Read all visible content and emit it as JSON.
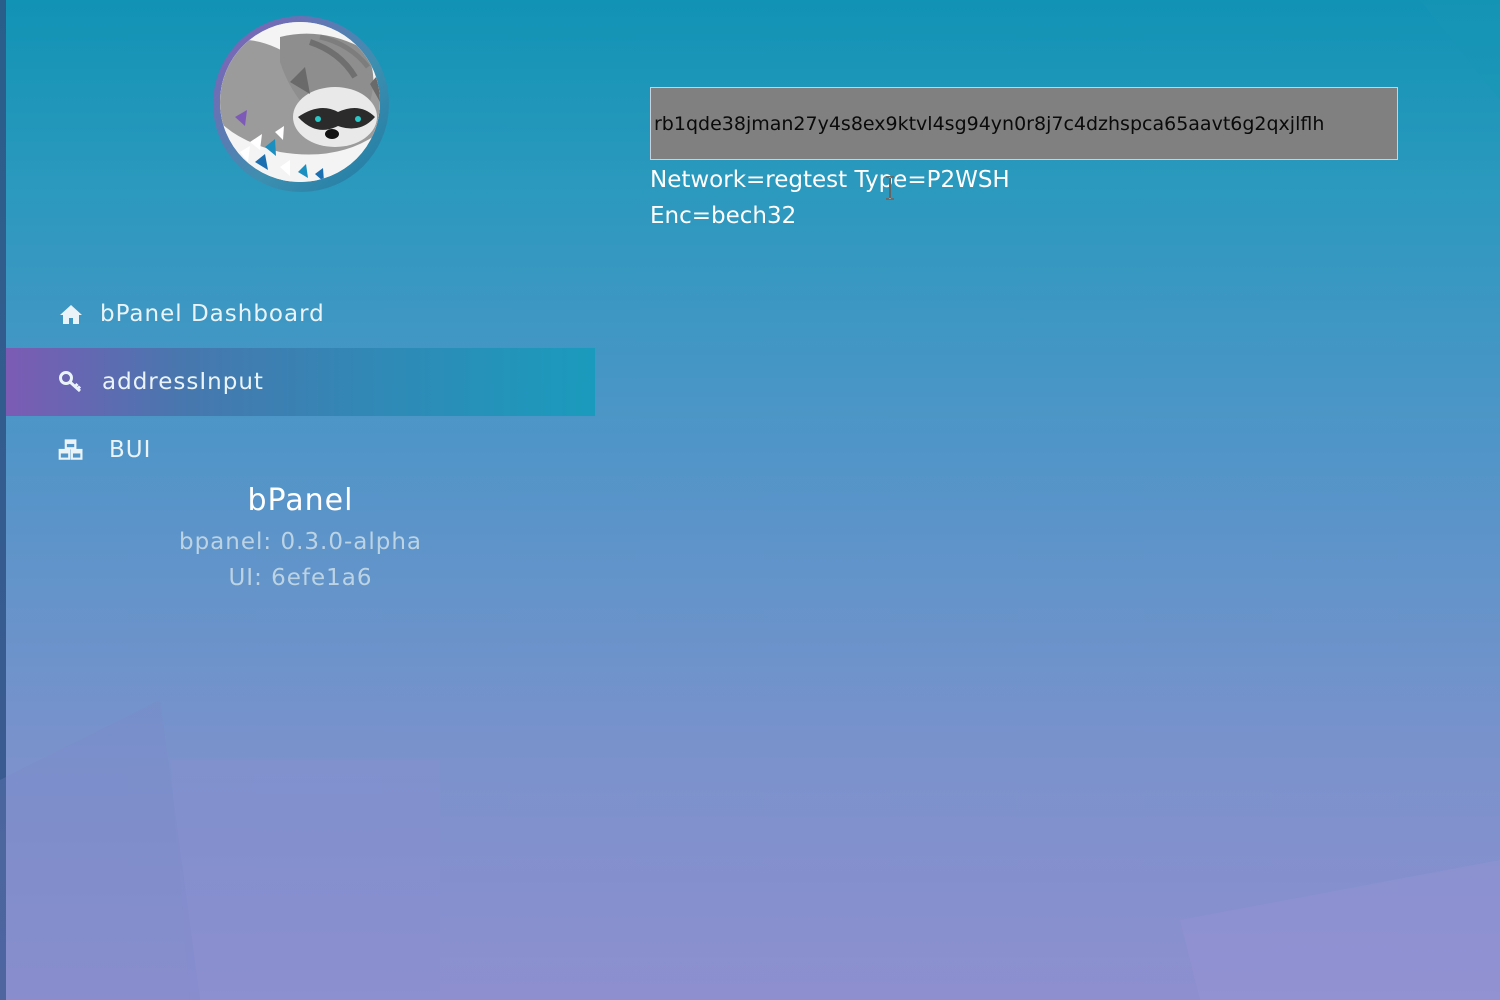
{
  "sidebar": {
    "avatar_alt": "raccoon avatar",
    "nav": [
      {
        "label": "bPanel Dashboard",
        "icon": "home-icon",
        "active": false
      },
      {
        "label": "addressInput",
        "icon": "key-icon",
        "active": true
      },
      {
        "label": "BUI",
        "icon": "cubes-icon",
        "active": false
      }
    ],
    "brand": {
      "title": "bPanel",
      "version_line": "bpanel: 0.3.0-alpha",
      "ui_line": "UI: 6efe1a6"
    }
  },
  "main": {
    "address": "rb1qde38jman27y4s8ex9ktvl4sg94yn0r8j7c4dzhspca65aavt6g2qxjlflh",
    "info_line1": "Network=regtest Type=P2WSH",
    "info_line2": "Enc=bech32"
  },
  "colors": {
    "active_nav_start": "#7c5bb4",
    "active_nav_end": "#1a9bbd",
    "address_box_bg": "#808080"
  }
}
